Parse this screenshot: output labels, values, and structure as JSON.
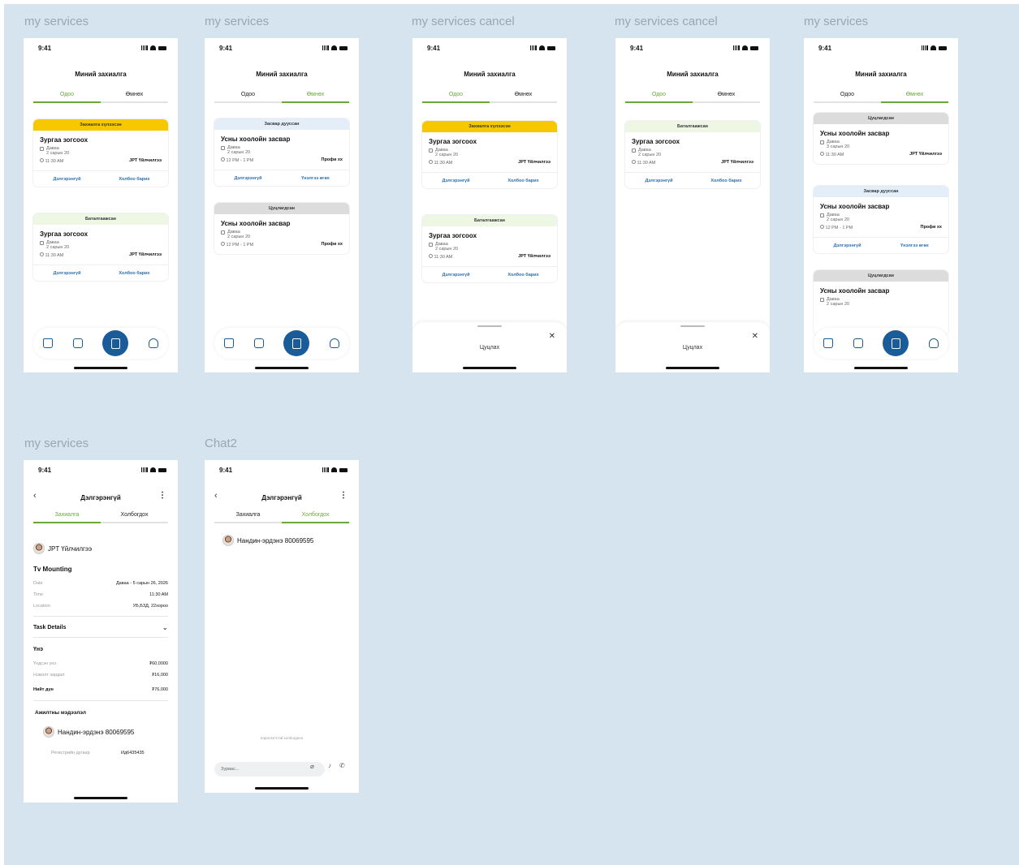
{
  "frames": {
    "f1": "my services",
    "f2": "my services",
    "f3": "my services cancel",
    "f4": "my services cancel",
    "f5": "my services",
    "f6": "my services",
    "f7": "Chat2"
  },
  "status": {
    "time": "9:41"
  },
  "header": {
    "title": "Миний захиалга",
    "tab_now": "Одоо",
    "tab_before": "Өмнөх"
  },
  "badges": {
    "pending": "Захиалга хүлээсэн",
    "confirmed": "Баталгаажсан",
    "repaired": "Засвар дууссан",
    "cancelled": "Цуцлагдсан",
    "yellow_color": "#f7c800",
    "green_color": "#eef6e4",
    "blue_color": "#e3eef9",
    "gray_color": "#dcdcdc"
  },
  "cards": {
    "title_stop": "Зургаа зогсоох",
    "title_hair": "Усны хоолойн засвар",
    "day": "Даваа",
    "date": "2 сарын 20",
    "date2": "3 сарын 20",
    "time_am": "11:30 AM",
    "time_pm": "12 PM - 1 PM",
    "provider_jpt": "JPT Үйлчилгээ",
    "provider_pro": "Профи хх",
    "act_details": "Дэлгэрэнгүй",
    "act_contact": "Холбоо барих",
    "act_review": "Үнэлгээ өгөх"
  },
  "sheet": {
    "label": "Цуцлах"
  },
  "detail": {
    "title": "Дэлгэрэнгүй",
    "tab_order": "Захиалга",
    "tab_contact": "Холбогдох",
    "provider": "JPT Үйлчилгээ",
    "service": "Tv Mounting",
    "date_label": "Date",
    "date_value": "Даваа - 5 сарын 26, 2026",
    "time_label": "Time",
    "time_value": "11:30 AM",
    "location_label": "Location",
    "location_value": "УБ,БЗД, 22хороо",
    "task_details": "Task Details",
    "price_head": "Үнэ",
    "price_label": "Үндсэн үнэ",
    "price_value": "₮60,0000",
    "extra_label": "Нэмэлт зардал",
    "extra_value": "₮16,000",
    "total_label": "Нийт дүн",
    "total_value": "₮76,000",
    "worker_head": "Ажилтны мэдээлэл",
    "worker_name": "Нандин-эрдэнэ 80069595",
    "reg_label": "Регистрийн дугаар",
    "reg_value": "Ид6435435"
  },
  "chat": {
    "title": "Дэлгэрэнгүй",
    "tab_order": "Захиалга",
    "tab_contact": "Холбогдох",
    "contact_name": "Нандин-эрдэнэ 80069595",
    "hint": "Хэрэглэгчтэй холбогдоно",
    "input_placeholder": "Зурвас..."
  },
  "icons": [
    "home-icon",
    "clipboard-icon",
    "orders-icon",
    "user-icon",
    "calendar-icon",
    "clock-icon",
    "close-icon",
    "back-icon",
    "more-icon",
    "chevron-down-icon",
    "attach-icon",
    "mic-icon",
    "phone-icon"
  ],
  "accent": "#6aa83a",
  "brand": "#1a5c9a"
}
